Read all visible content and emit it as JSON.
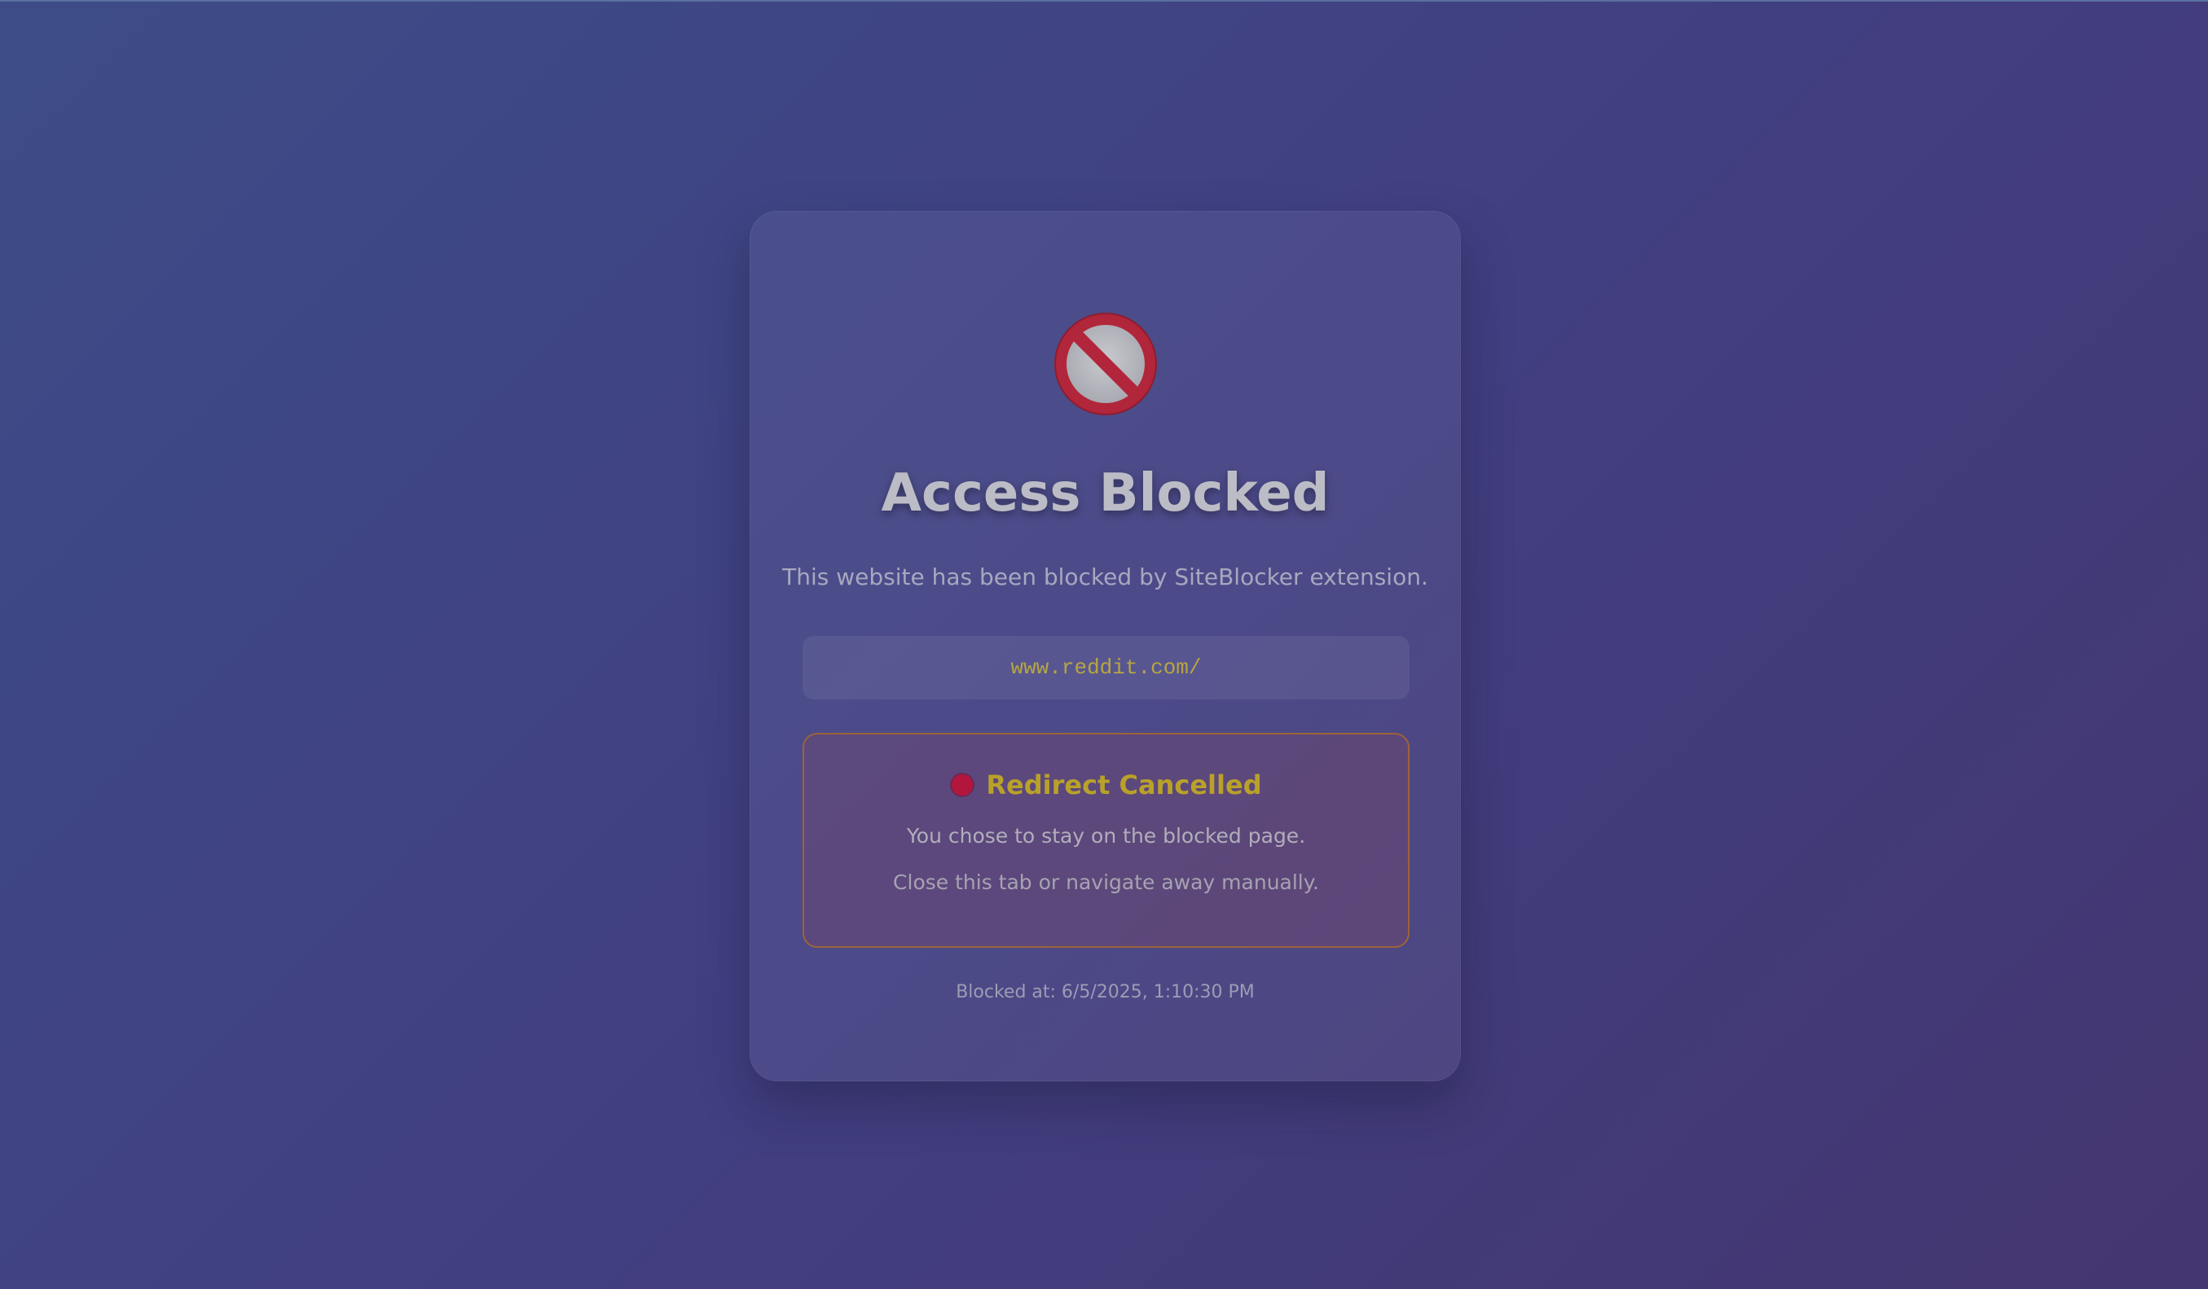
{
  "page": {
    "title": "Access Blocked",
    "subtitle": "This website has been blocked by SiteBlocker extension.",
    "blocked_url": "www.reddit.com/",
    "notice": {
      "title": "Redirect Cancelled",
      "line1": "You chose to stay on the blocked page.",
      "line2": "Close this tab or navigate away manually."
    },
    "blocked_at": "Blocked at: 6/5/2025, 1:10:30 PM"
  },
  "icons": {
    "blocked": "prohibited-icon",
    "status": "red-circle-icon"
  },
  "colors": {
    "background_start": "#3d4c87",
    "background_end": "#443670",
    "title": "#bcbcc6",
    "url": "#b6a641",
    "notice_border": "#9c6439",
    "notice_title": "#b9a12a",
    "status_dot": "#b3163c"
  }
}
